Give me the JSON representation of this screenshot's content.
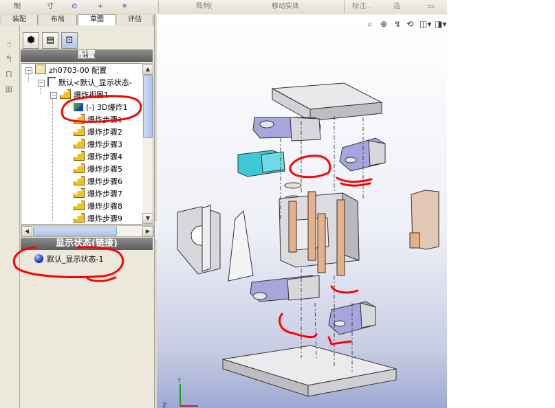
{
  "toolbar": {
    "items": [
      "制",
      "寸",
      "⊙",
      "+",
      "✳",
      "阵列(",
      "移动实体",
      "标注...",
      "选"
    ],
    "move_entity": "移动实体"
  },
  "tabs": [
    {
      "label": "装配",
      "active": false
    },
    {
      "label": "布局",
      "active": false
    },
    {
      "label": "草图",
      "active": true
    },
    {
      "label": "评估",
      "active": false
    }
  ],
  "config_panel": {
    "header": "配置",
    "tree": {
      "root": "zh0703-00 配置",
      "config": "默认<默认_显示状态-",
      "explode_view": "爆炸视图1",
      "explode_3d": "(-) 3D爆炸1",
      "steps": [
        "爆炸步骤1",
        "爆炸步骤2",
        "爆炸步骤3",
        "爆炸步骤4",
        "爆炸步骤5",
        "爆炸步骤6",
        "爆炸步骤7",
        "爆炸步骤8",
        "爆炸步骤9"
      ]
    }
  },
  "display_states": {
    "header": "显示状态(链接)",
    "items": [
      "默认_显示状态-1"
    ]
  },
  "colors": {
    "annotation": "#ff0000",
    "panel_header": "#6e6e6e",
    "part_body": "#c9c9ce",
    "part_purple": "#9a96d4",
    "part_cyan": "#3ec7d6",
    "pin": "#e6b08a"
  },
  "icons": {
    "view_tools": [
      "zoom-fit-icon",
      "zoom-area-icon",
      "pan-icon",
      "rotate-icon",
      "view-orientation-icon",
      "display-style-icon"
    ]
  }
}
